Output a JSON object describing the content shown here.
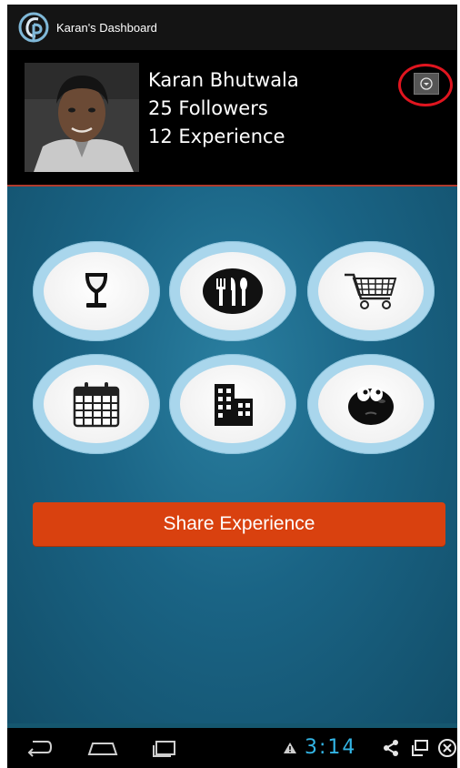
{
  "app": {
    "title": "Karan's Dashboard"
  },
  "profile": {
    "name": "Karan Bhutwala",
    "followers": "25 Followers",
    "experience": "12 Experience"
  },
  "categories": [
    {
      "icon": "wine-glass-icon"
    },
    {
      "icon": "restaurant-icon"
    },
    {
      "icon": "shopping-cart-icon"
    },
    {
      "icon": "calendar-icon"
    },
    {
      "icon": "buildings-icon"
    },
    {
      "icon": "smiley-icon"
    }
  ],
  "share_button": {
    "label": "Share Experience"
  },
  "status_bar": {
    "time": "3:14"
  },
  "colors": {
    "accent": "#d9410f",
    "clock": "#33b5e5",
    "highlight_circle": "#e0151f",
    "background": "#15576f"
  }
}
